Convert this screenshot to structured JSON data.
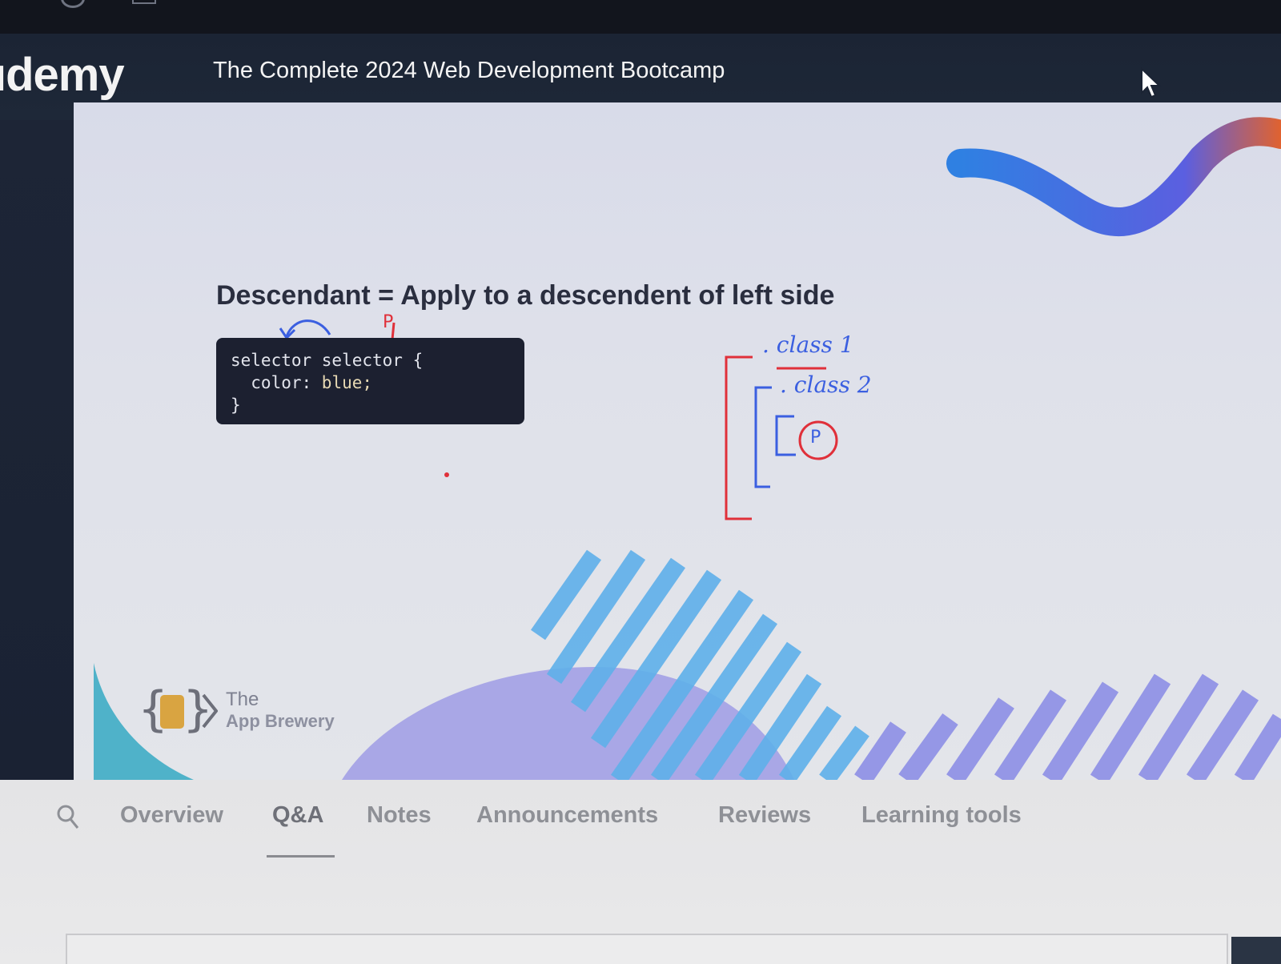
{
  "header": {
    "logo": "ıdemy",
    "course_title": "The Complete 2024 Web Development Bootcamp"
  },
  "slide": {
    "heading": "Descendant = Apply to a descendent of left side",
    "code": {
      "line1": "selector selector {",
      "line2_prop": "  color: ",
      "line2_val": "blue;",
      "line3": "}"
    },
    "annotations": {
      "class1": ". class 1",
      "class2": ". class 2",
      "p_label": "P",
      "p_marker": "P"
    },
    "brand": {
      "the": "The",
      "name": "App Brewery"
    }
  },
  "tabs": [
    {
      "label": "Overview",
      "active": false
    },
    {
      "label": "Q&A",
      "active": true
    },
    {
      "label": "Notes",
      "active": false
    },
    {
      "label": "Announcements",
      "active": false
    },
    {
      "label": "Reviews",
      "active": false
    },
    {
      "label": "Learning tools",
      "active": false
    }
  ],
  "icons": {
    "search": "search-icon",
    "cursor": "mouse-pointer-icon",
    "brand_logo": "curly-braces-logo-icon"
  },
  "colors": {
    "wave_blue": "#2f7fe0",
    "wave_orange": "#e0622f",
    "stripes": "#5fb0ea",
    "stripes_purple": "#8d8fe6",
    "pen_blue": "#3b5fe0",
    "pen_red": "#e0303a"
  }
}
